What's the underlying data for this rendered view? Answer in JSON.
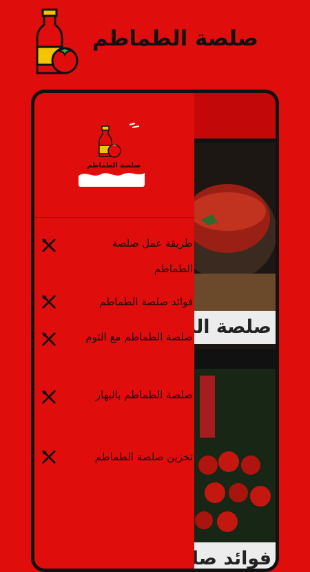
{
  "header": {
    "title": "صلصة الطماطم"
  },
  "drawer": {
    "logo_text": "صلصة الطماطم",
    "items": [
      {
        "label": "طريقة عمل صلصة الطماطم",
        "icon": "fork-knife-icon"
      },
      {
        "label": "فوائد صلصة الطماطم",
        "icon": "fork-knife-icon"
      },
      {
        "label": "صلصة الطماطم مع الثوم",
        "icon": "fork-knife-icon"
      },
      {
        "label": "صلصة الطماطم بالبهار",
        "icon": "fork-knife-icon"
      },
      {
        "label": "تخزين صلصة الطماطم",
        "icon": "fork-knife-icon"
      }
    ]
  },
  "cards": [
    {
      "title": "صلصة الطماطم"
    },
    {
      "title": "فوائد صلصة الطماطم"
    }
  ],
  "colors": {
    "brand_red": "#e00d0d",
    "dark_red": "#c20808",
    "frame": "#111111"
  }
}
